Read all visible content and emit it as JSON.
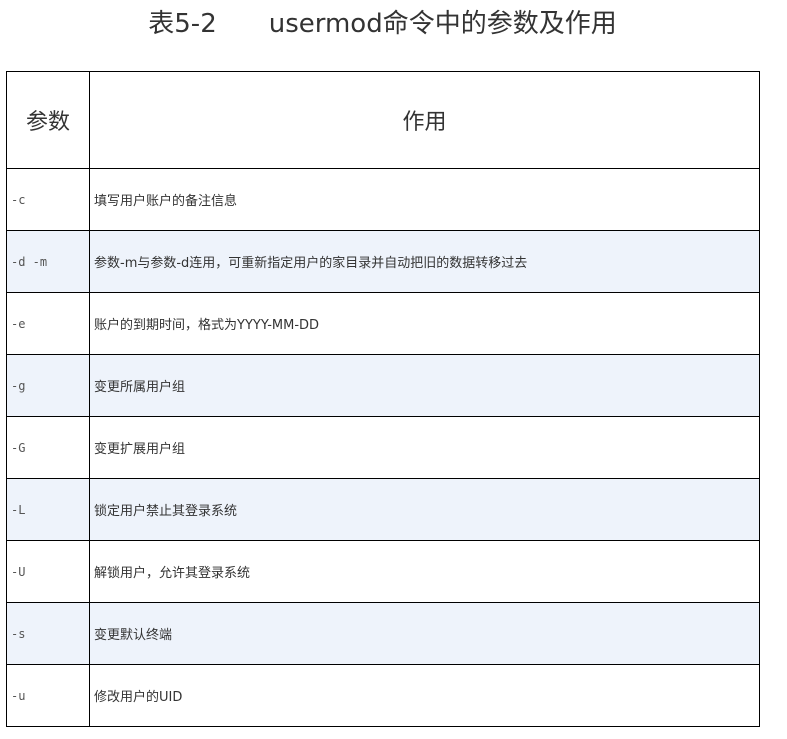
{
  "caption": "表5-2　　usermod命令中的参数及作用",
  "table": {
    "headers": [
      "参数",
      "作用"
    ],
    "rows": [
      {
        "param": "-c",
        "desc": "填写用户账户的备注信息"
      },
      {
        "param": "-d -m",
        "desc": "参数-m与参数-d连用，可重新指定用户的家目录并自动把旧的数据转移过去"
      },
      {
        "param": "-e",
        "desc": "账户的到期时间，格式为YYYY-MM-DD"
      },
      {
        "param": "-g",
        "desc": "变更所属用户组"
      },
      {
        "param": "-G",
        "desc": "变更扩展用户组"
      },
      {
        "param": "-L",
        "desc": "锁定用户禁止其登录系统"
      },
      {
        "param": "-U",
        "desc": "解锁用户，允许其登录系统"
      },
      {
        "param": "-s",
        "desc": "变更默认终端"
      },
      {
        "param": "-u",
        "desc": "修改用户的UID"
      }
    ]
  }
}
